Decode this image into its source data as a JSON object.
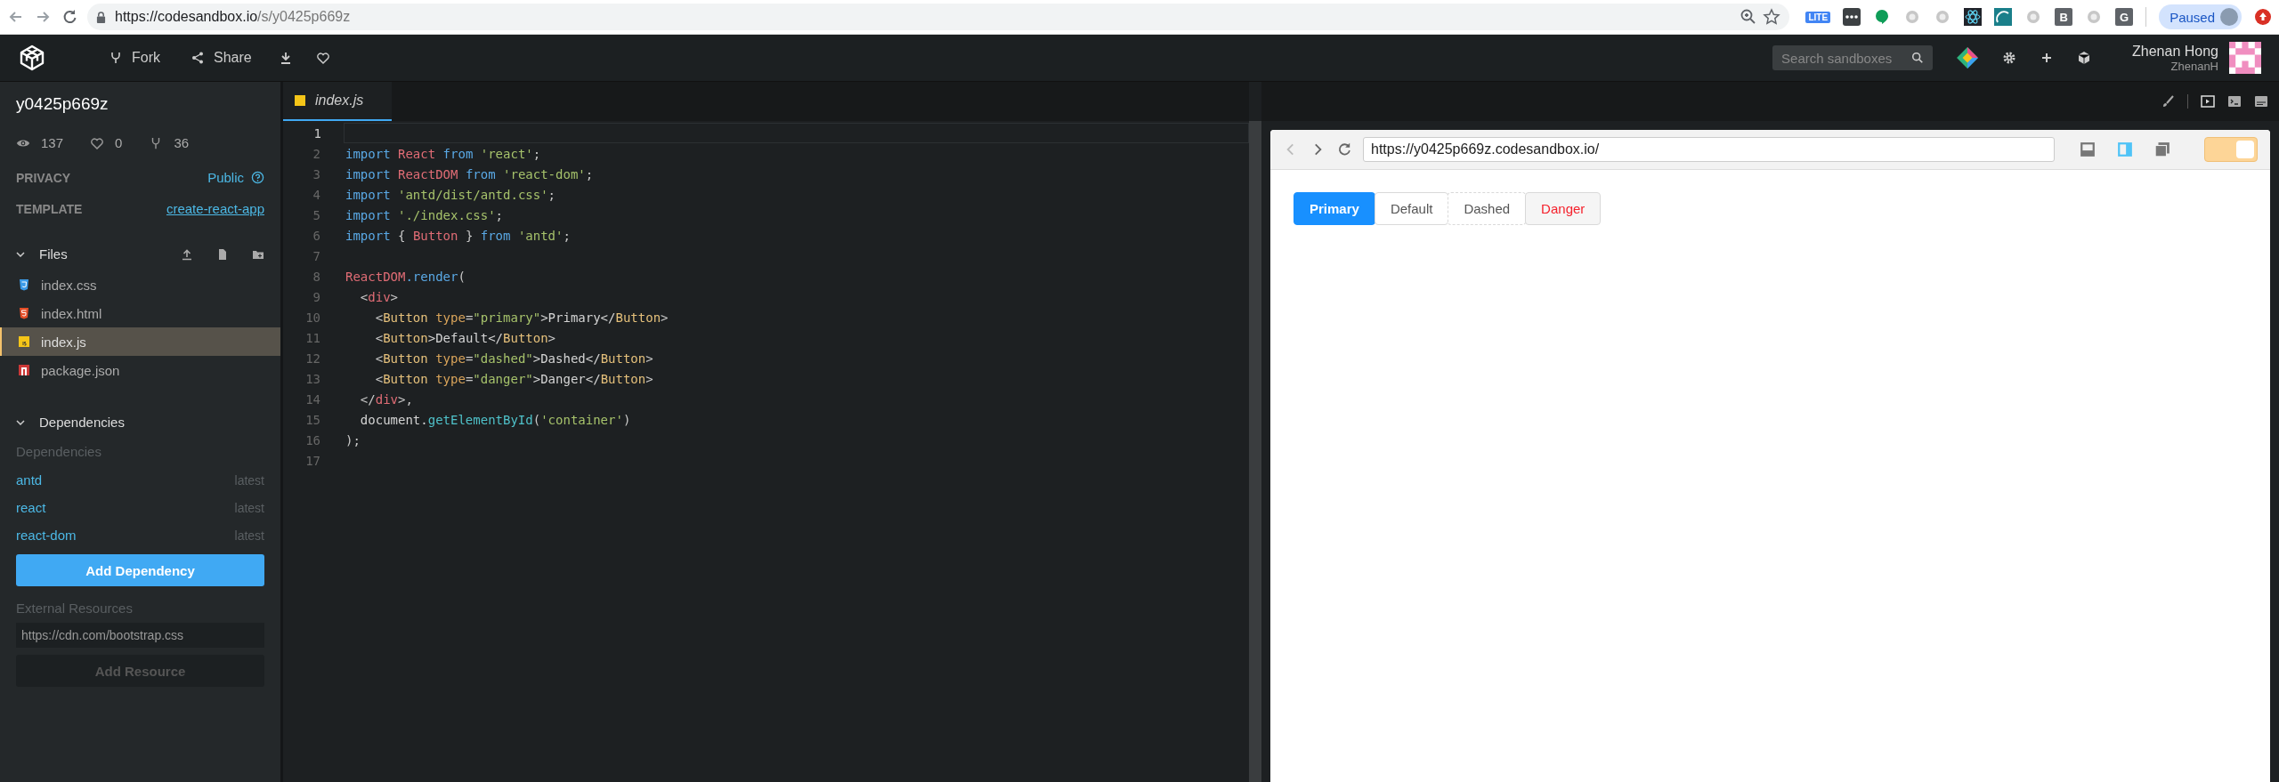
{
  "browser": {
    "url_host": "https://codesandbox.io",
    "url_path": "/s/y0425p669z",
    "extensions": [
      {
        "kind": "badge",
        "label": "LITE"
      },
      {
        "kind": "dots"
      },
      {
        "kind": "green"
      },
      {
        "kind": "plain"
      },
      {
        "kind": "plain"
      },
      {
        "kind": "react"
      },
      {
        "kind": "teal"
      },
      {
        "kind": "plain"
      },
      {
        "kind": "letter",
        "label": "B"
      },
      {
        "kind": "plain"
      },
      {
        "kind": "letter",
        "label": "G"
      }
    ],
    "profile_status": "Paused"
  },
  "header": {
    "actions": [
      {
        "kind": "fork",
        "label": "Fork"
      },
      {
        "kind": "share",
        "label": "Share"
      },
      {
        "kind": "download"
      },
      {
        "kind": "like"
      }
    ],
    "search": {
      "placeholder": "Search sandboxes"
    },
    "user": {
      "name": "Zhenan Hong",
      "handle": "ZhenanH"
    }
  },
  "sidebar": {
    "title": "y0425p669z",
    "stats": [
      {
        "kind": "views",
        "value": "137"
      },
      {
        "kind": "likes",
        "value": "0"
      },
      {
        "kind": "forks",
        "value": "36"
      }
    ],
    "privacy": {
      "label": "PRIVACY",
      "value": "Public"
    },
    "template": {
      "label": "TEMPLATE",
      "value": "create-react-app"
    },
    "files_section": {
      "title": "Files",
      "expanded": true
    },
    "files": [
      {
        "name": "index.css",
        "kind": "css",
        "selected": false
      },
      {
        "name": "index.html",
        "kind": "html",
        "selected": false
      },
      {
        "name": "index.js",
        "kind": "js",
        "selected": true
      },
      {
        "name": "package.json",
        "kind": "npm",
        "selected": false
      }
    ],
    "dependencies_section": {
      "title": "Dependencies",
      "expanded": true
    },
    "dependencies_label": "Dependencies",
    "dependencies": [
      {
        "name": "antd",
        "version": "latest"
      },
      {
        "name": "react",
        "version": "latest"
      },
      {
        "name": "react-dom",
        "version": "latest"
      }
    ],
    "add_dependency": "Add Dependency",
    "external_label": "External Resources",
    "resource_field": {
      "placeholder": "https://cdn.com/bootstrap.css"
    },
    "add_resource": "Add Resource"
  },
  "editor": {
    "tabs": [
      {
        "name": "index.js",
        "selected": true
      }
    ],
    "lines": [
      {
        "number": "1"
      },
      {
        "number": "2",
        "tokens": [
          {
            "kind": "keyword",
            "text": "import "
          },
          {
            "kind": "name",
            "text": "React "
          },
          {
            "kind": "keyword",
            "text": "from "
          },
          {
            "kind": "string",
            "text": "'react'"
          },
          {
            "kind": "punct",
            "text": ";"
          }
        ]
      },
      {
        "number": "3",
        "tokens": [
          {
            "kind": "keyword",
            "text": "import "
          },
          {
            "kind": "name",
            "text": "ReactDOM "
          },
          {
            "kind": "keyword",
            "text": "from "
          },
          {
            "kind": "string",
            "text": "'react-dom'"
          },
          {
            "kind": "punct",
            "text": ";"
          }
        ]
      },
      {
        "number": "4",
        "tokens": [
          {
            "kind": "keyword",
            "text": "import "
          },
          {
            "kind": "string",
            "text": "'antd/dist/antd.css'"
          },
          {
            "kind": "punct",
            "text": ";"
          }
        ]
      },
      {
        "number": "5",
        "tokens": [
          {
            "kind": "keyword",
            "text": "import "
          },
          {
            "kind": "string",
            "text": "'./index.css'"
          },
          {
            "kind": "punct",
            "text": ";"
          }
        ]
      },
      {
        "number": "6",
        "tokens": [
          {
            "kind": "keyword",
            "text": "import "
          },
          {
            "kind": "punct",
            "text": "{ "
          },
          {
            "kind": "name",
            "text": "Button"
          },
          {
            "kind": "punct",
            "text": " } "
          },
          {
            "kind": "keyword",
            "text": "from "
          },
          {
            "kind": "string",
            "text": "'antd'"
          },
          {
            "kind": "punct",
            "text": ";"
          }
        ]
      },
      {
        "number": "7"
      },
      {
        "number": "8",
        "tokens": [
          {
            "kind": "name",
            "text": "ReactDOM"
          },
          {
            "kind": "keyword",
            "text": ".render"
          },
          {
            "kind": "punct",
            "text": "("
          }
        ]
      },
      {
        "number": "9",
        "tokens": [
          {
            "kind": "punct",
            "text": "  <"
          },
          {
            "kind": "name",
            "text": "div"
          },
          {
            "kind": "punct",
            "text": ">"
          }
        ]
      },
      {
        "number": "10",
        "tokens": [
          {
            "kind": "punct",
            "text": "    <"
          },
          {
            "kind": "component",
            "text": "Button "
          },
          {
            "kind": "attr",
            "text": "type"
          },
          {
            "kind": "punct",
            "text": "="
          },
          {
            "kind": "string",
            "text": "\"primary\""
          },
          {
            "kind": "plain",
            "text": ">Primary</"
          },
          {
            "kind": "component",
            "text": "Button"
          },
          {
            "kind": "punct",
            "text": ">"
          }
        ]
      },
      {
        "number": "11",
        "tokens": [
          {
            "kind": "punct",
            "text": "    <"
          },
          {
            "kind": "component",
            "text": "Button"
          },
          {
            "kind": "plain",
            "text": ">Default</"
          },
          {
            "kind": "component",
            "text": "Button"
          },
          {
            "kind": "punct",
            "text": ">"
          }
        ]
      },
      {
        "number": "12",
        "tokens": [
          {
            "kind": "punct",
            "text": "    <"
          },
          {
            "kind": "component",
            "text": "Button "
          },
          {
            "kind": "attr",
            "text": "type"
          },
          {
            "kind": "punct",
            "text": "="
          },
          {
            "kind": "string",
            "text": "\"dashed\""
          },
          {
            "kind": "plain",
            "text": ">Dashed</"
          },
          {
            "kind": "component",
            "text": "Button"
          },
          {
            "kind": "punct",
            "text": ">"
          }
        ]
      },
      {
        "number": "13",
        "tokens": [
          {
            "kind": "punct",
            "text": "    <"
          },
          {
            "kind": "component",
            "text": "Button "
          },
          {
            "kind": "attr",
            "text": "type"
          },
          {
            "kind": "punct",
            "text": "="
          },
          {
            "kind": "string",
            "text": "\"danger\""
          },
          {
            "kind": "plain",
            "text": ">Danger</"
          },
          {
            "kind": "component",
            "text": "Button"
          },
          {
            "kind": "punct",
            "text": ">"
          }
        ]
      },
      {
        "number": "14",
        "tokens": [
          {
            "kind": "punct",
            "text": "  </"
          },
          {
            "kind": "name",
            "text": "div"
          },
          {
            "kind": "punct",
            "text": ">,"
          }
        ]
      },
      {
        "number": "15",
        "tokens": [
          {
            "kind": "plain",
            "text": "  document."
          },
          {
            "kind": "method",
            "text": "getElementById"
          },
          {
            "kind": "punct",
            "text": "("
          },
          {
            "kind": "string",
            "text": "'container'"
          },
          {
            "kind": "punct",
            "text": ")"
          }
        ]
      },
      {
        "number": "16",
        "tokens": [
          {
            "kind": "punct",
            "text": ");"
          }
        ]
      },
      {
        "number": "17"
      }
    ]
  },
  "preview": {
    "url": "https://y0425p669z.codesandbox.io/",
    "views": [
      {
        "kind": "console",
        "selected": false
      },
      {
        "kind": "split",
        "selected": true
      },
      {
        "kind": "window",
        "selected": false
      }
    ],
    "toggle": {
      "on": true
    },
    "buttons": [
      {
        "label": "Primary",
        "kind": "primary"
      },
      {
        "label": "Default",
        "kind": "default"
      },
      {
        "label": "Dashed",
        "kind": "dashed"
      },
      {
        "label": "Danger",
        "kind": "danger"
      }
    ]
  }
}
